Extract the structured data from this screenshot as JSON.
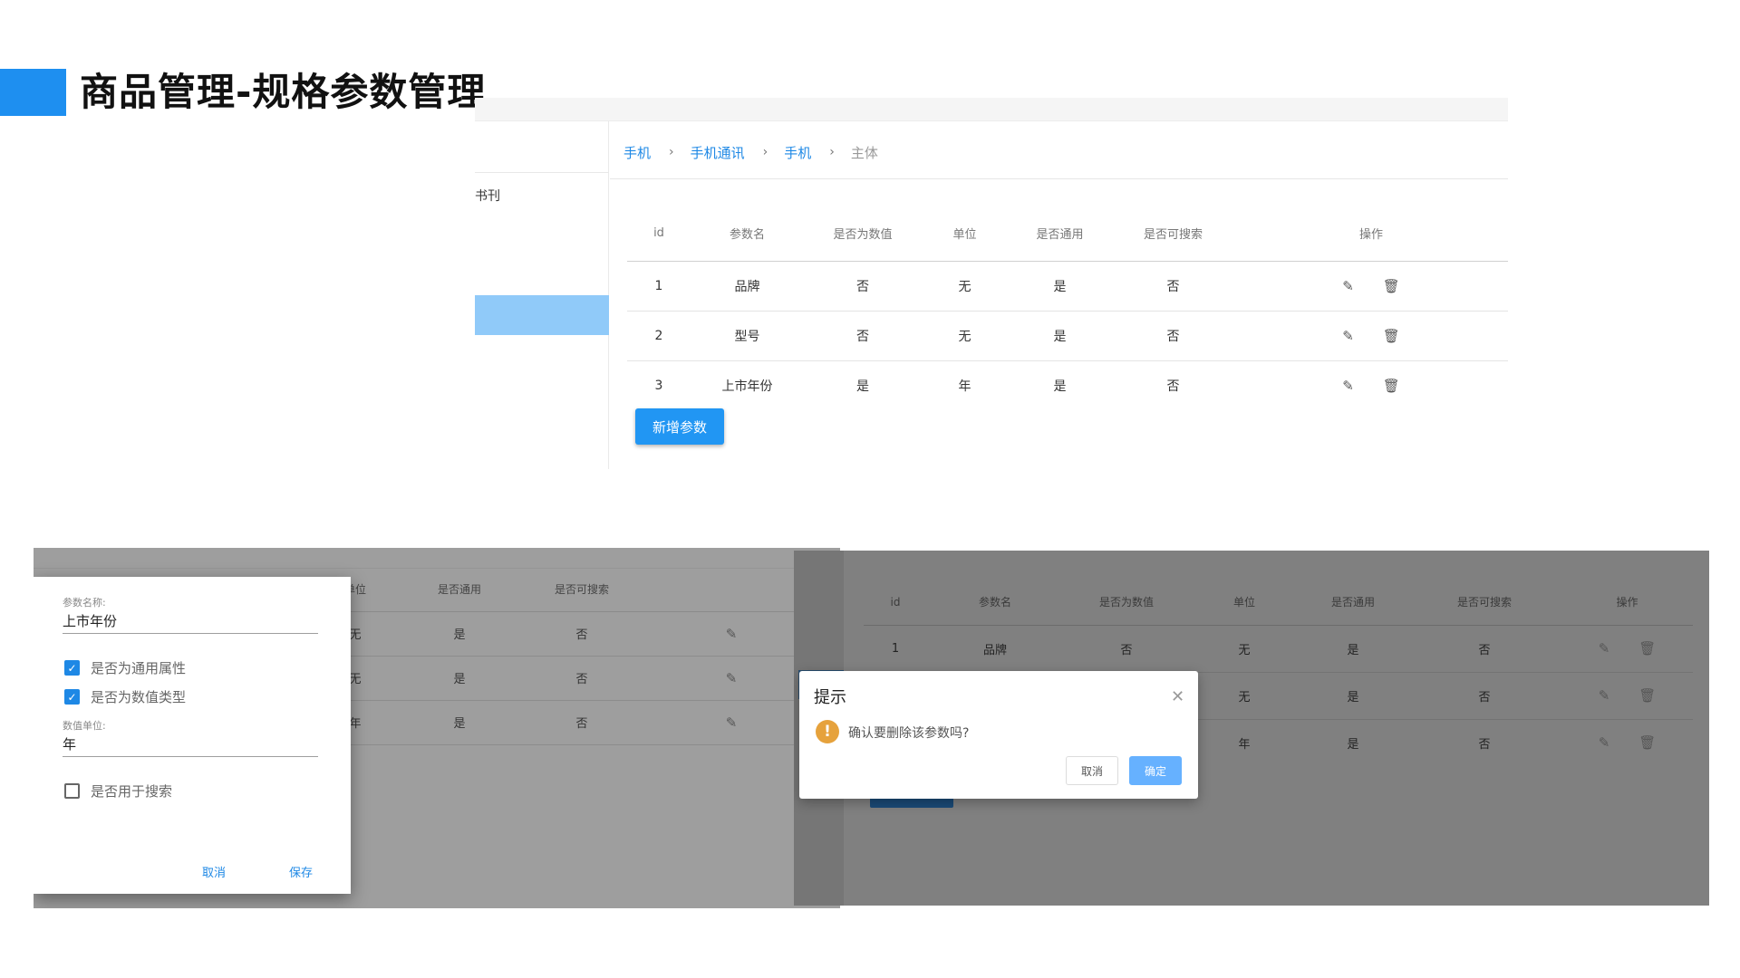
{
  "slide": {
    "title": "商品管理-规格参数管理",
    "accent_color": "#1e8ff0"
  },
  "main_view": {
    "sidebar_item": "书刊",
    "breadcrumb": [
      {
        "label": "手机"
      },
      {
        "label": "手机通讯"
      },
      {
        "label": "手机"
      },
      {
        "label": "主体"
      }
    ],
    "breadcrumb_separator": "›",
    "columns": [
      "id",
      "参数名",
      "是否为数值",
      "单位",
      "是否通用",
      "是否可搜索",
      "操作"
    ],
    "rows": [
      [
        "1",
        "品牌",
        "否",
        "无",
        "是",
        "否"
      ],
      [
        "2",
        "型号",
        "否",
        "无",
        "是",
        "否"
      ],
      [
        "3",
        "上市年份",
        "是",
        "年",
        "是",
        "否"
      ]
    ],
    "icons": {
      "edit": "edit-pencil-icon",
      "delete": "trash-icon"
    },
    "add_button": "新增参数",
    "primary_color": "#2196f3"
  },
  "edit_view": {
    "bg_columns": [
      "单位",
      "是否通用",
      "是否可搜索"
    ],
    "bg_rows": [
      [
        "无",
        "是",
        "否"
      ],
      [
        "无",
        "是",
        "否"
      ],
      [
        "年",
        "是",
        "否"
      ]
    ],
    "dialog": {
      "name_label": "参数名称:",
      "name_value": "上市年份",
      "generic_label": "是否为通用属性",
      "generic_checked": true,
      "numeric_label": "是否为数值类型",
      "numeric_checked": true,
      "unit_label": "数值单位:",
      "unit_value": "年",
      "search_label": "是否用于搜索",
      "search_checked": false,
      "cancel": "取消",
      "save": "保存"
    }
  },
  "delete_view": {
    "columns": [
      "id",
      "参数名",
      "是否为数值",
      "单位",
      "是否通用",
      "是否可搜索",
      "操作"
    ],
    "rows": [
      [
        "1",
        "品牌",
        "否",
        "无",
        "是",
        "否"
      ],
      [
        "",
        "",
        "",
        "无",
        "是",
        "否"
      ],
      [
        "",
        "",
        "",
        "年",
        "是",
        "否"
      ]
    ],
    "dialog": {
      "title": "提示",
      "message": "确认要删除该参数吗?",
      "cancel": "取消",
      "confirm": "确定",
      "warning_color": "#e6a23c"
    }
  }
}
